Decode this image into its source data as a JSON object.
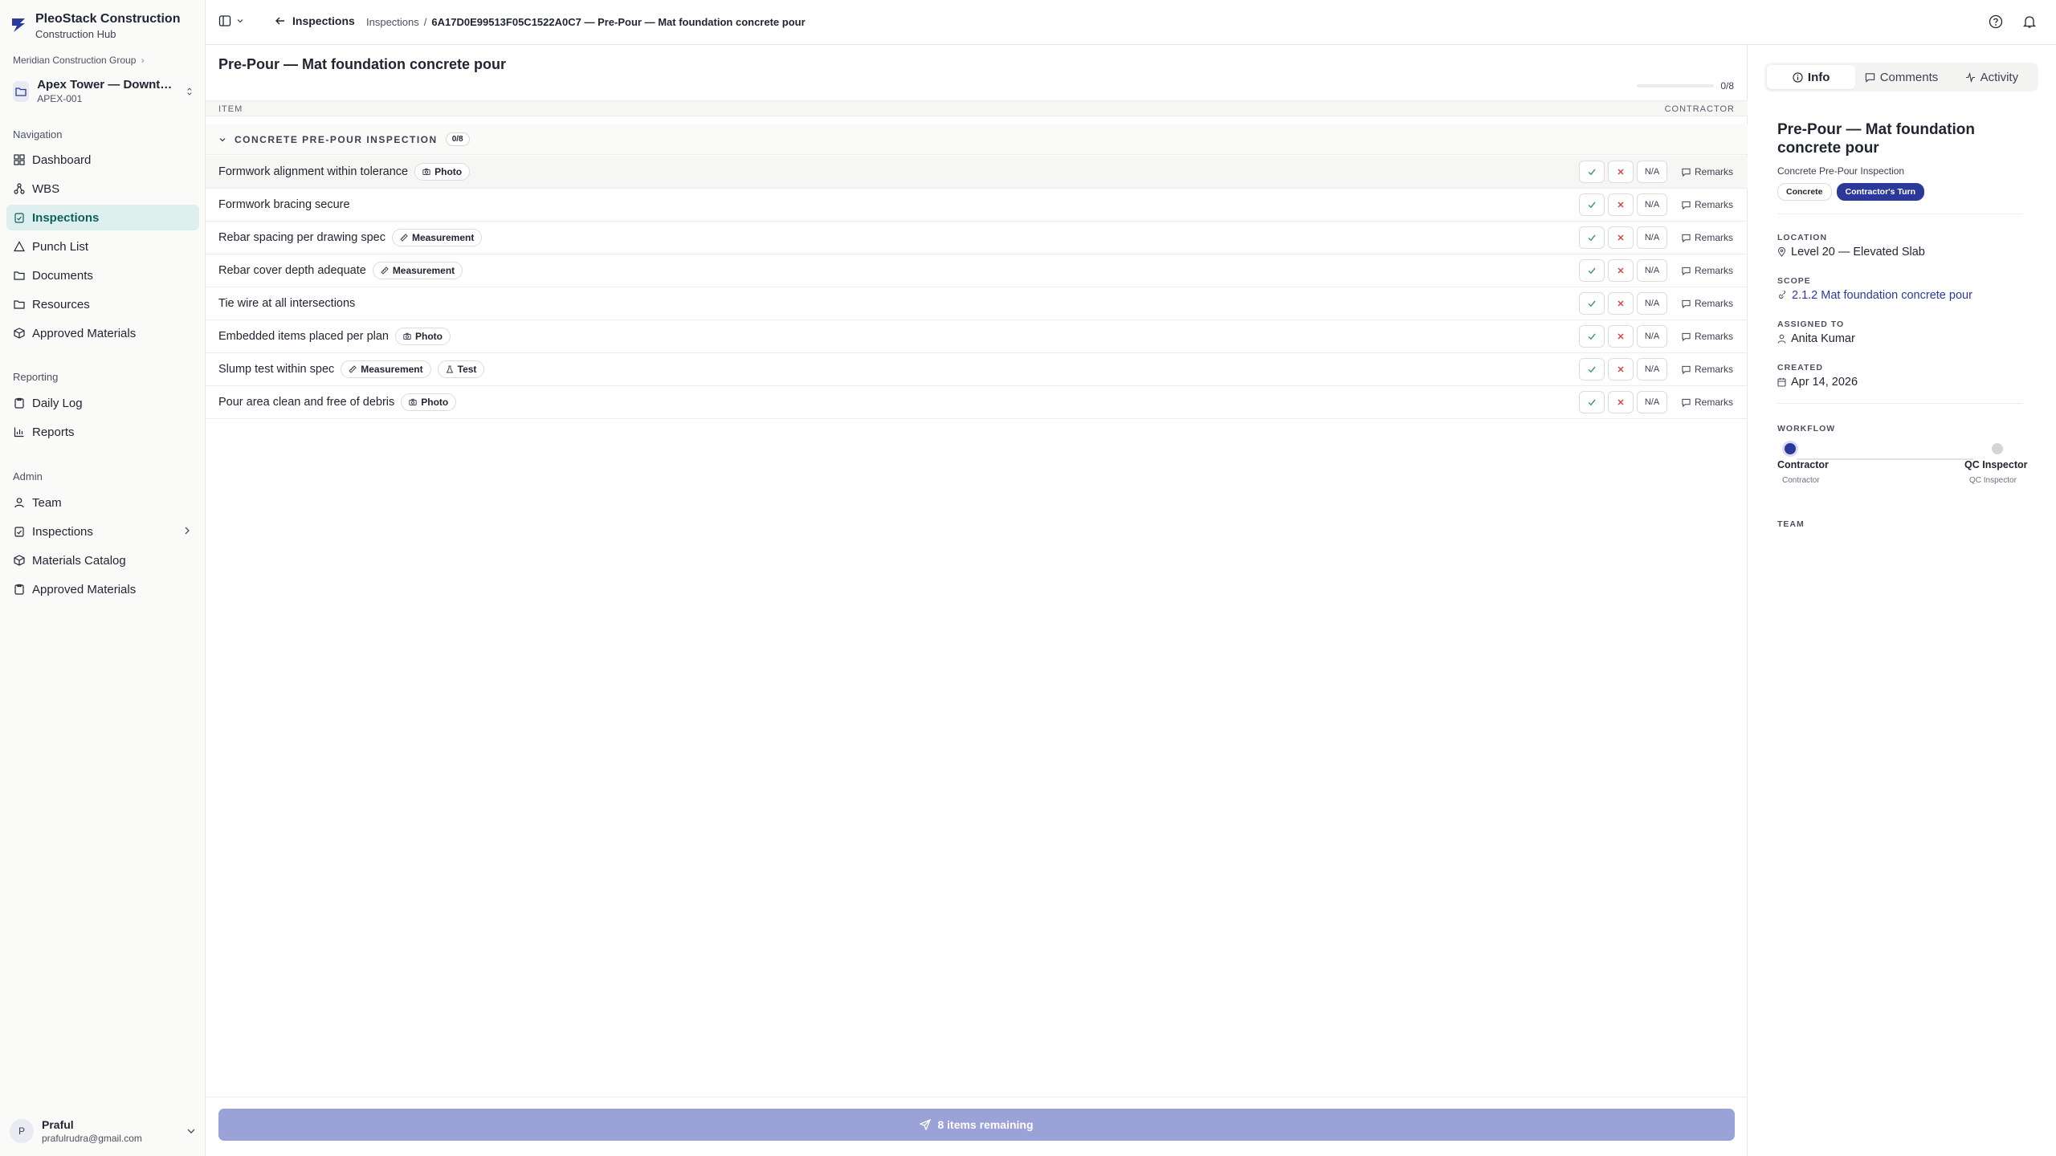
{
  "brand": {
    "name": "PleoStack Construction",
    "subtitle": "Construction Hub"
  },
  "org": {
    "name": "Meridian Construction Group",
    "chevron": "›"
  },
  "project": {
    "name": "Apex Tower — Downtow...",
    "code": "APEX-001"
  },
  "nav": {
    "section_navigation": "Navigation",
    "section_reporting": "Reporting",
    "section_admin": "Admin",
    "items": [
      {
        "label": "Dashboard",
        "icon": "grid-icon"
      },
      {
        "label": "WBS",
        "icon": "hierarchy-icon"
      },
      {
        "label": "Inspections",
        "icon": "clipboard-check-icon"
      },
      {
        "label": "Punch List",
        "icon": "alert-triangle-icon"
      },
      {
        "label": "Documents",
        "icon": "folder-icon"
      },
      {
        "label": "Resources",
        "icon": "folder-icon"
      },
      {
        "label": "Approved Materials",
        "icon": "box-icon"
      }
    ],
    "reporting_items": [
      {
        "label": "Daily Log",
        "icon": "clipboard-icon"
      },
      {
        "label": "Reports",
        "icon": "bar-chart-icon"
      }
    ],
    "admin_items": [
      {
        "label": "Team",
        "icon": "user-icon"
      },
      {
        "label": "Inspections",
        "icon": "clipboard-check-icon"
      },
      {
        "label": "Materials Catalog",
        "icon": "box-icon"
      },
      {
        "label": "Approved Materials",
        "icon": "clipboard-icon"
      }
    ]
  },
  "user": {
    "initial": "P",
    "name": "Praful",
    "email": "prafulrudra@gmail.com"
  },
  "topbar": {
    "back_label": "Inspections",
    "breadcrumb_parent": "Inspections",
    "breadcrumb_sep": "/",
    "breadcrumb_current": "6A17D0E99513F05C1522A0C7 — Pre-Pour — Mat foundation concrete pour"
  },
  "main": {
    "title": "Pre-Pour — Mat foundation concrete pour",
    "progress_text": "0/8",
    "progress_fraction": 0,
    "col_item": "ITEM",
    "col_contractor": "CONTRACTOR",
    "group_title": "CONCRETE PRE-POUR INSPECTION",
    "group_count": "0/8",
    "na_label": "N/A",
    "remarks_label": "Remarks",
    "items": [
      {
        "label": "Formwork alignment within tolerance",
        "tags": [
          {
            "label": "Photo",
            "icon": "camera-icon"
          }
        ]
      },
      {
        "label": "Formwork bracing secure",
        "tags": []
      },
      {
        "label": "Rebar spacing per drawing spec",
        "tags": [
          {
            "label": "Measurement",
            "icon": "ruler-icon"
          }
        ]
      },
      {
        "label": "Rebar cover depth adequate",
        "tags": [
          {
            "label": "Measurement",
            "icon": "ruler-icon"
          }
        ]
      },
      {
        "label": "Tie wire at all intersections",
        "tags": []
      },
      {
        "label": "Embedded items placed per plan",
        "tags": [
          {
            "label": "Photo",
            "icon": "camera-icon"
          }
        ]
      },
      {
        "label": "Slump test within spec",
        "tags": [
          {
            "label": "Measurement",
            "icon": "ruler-icon"
          },
          {
            "label": "Test",
            "icon": "flask-icon"
          }
        ]
      },
      {
        "label": "Pour area clean and free of debris",
        "tags": [
          {
            "label": "Photo",
            "icon": "camera-icon"
          }
        ]
      }
    ],
    "submit_label": "8 items remaining"
  },
  "panel": {
    "tabs": [
      {
        "label": "Info",
        "icon": "info-icon",
        "active": true
      },
      {
        "label": "Comments",
        "icon": "message-icon",
        "active": false
      },
      {
        "label": "Activity",
        "icon": "activity-icon",
        "active": false
      }
    ],
    "title": "Pre-Pour — Mat foundation concrete pour",
    "subtitle": "Concrete Pre-Pour Inspection",
    "badge_category": "Concrete",
    "badge_status": "Contractor's Turn",
    "location_label": "LOCATION",
    "location_value": "Level 20 — Elevated Slab",
    "scope_label": "SCOPE",
    "scope_value": "2.1.2 Mat foundation concrete pour",
    "assigned_label": "ASSIGNED TO",
    "assigned_value": "Anita Kumar",
    "created_label": "CREATED",
    "created_value": "Apr 14, 2026",
    "workflow_label": "WORKFLOW",
    "workflow_steps": [
      {
        "name": "Contractor",
        "role": "Contractor",
        "active": true
      },
      {
        "name": "QC Inspector",
        "role": "QC Inspector",
        "active": false
      }
    ],
    "team_label": "TEAM"
  },
  "colors": {
    "accent": "#2b3a9a",
    "active_nav_bg": "#ddf0ee",
    "submit_disabled": "#9aa2d8",
    "check": "#3f9a7a",
    "cross": "#d64545"
  }
}
